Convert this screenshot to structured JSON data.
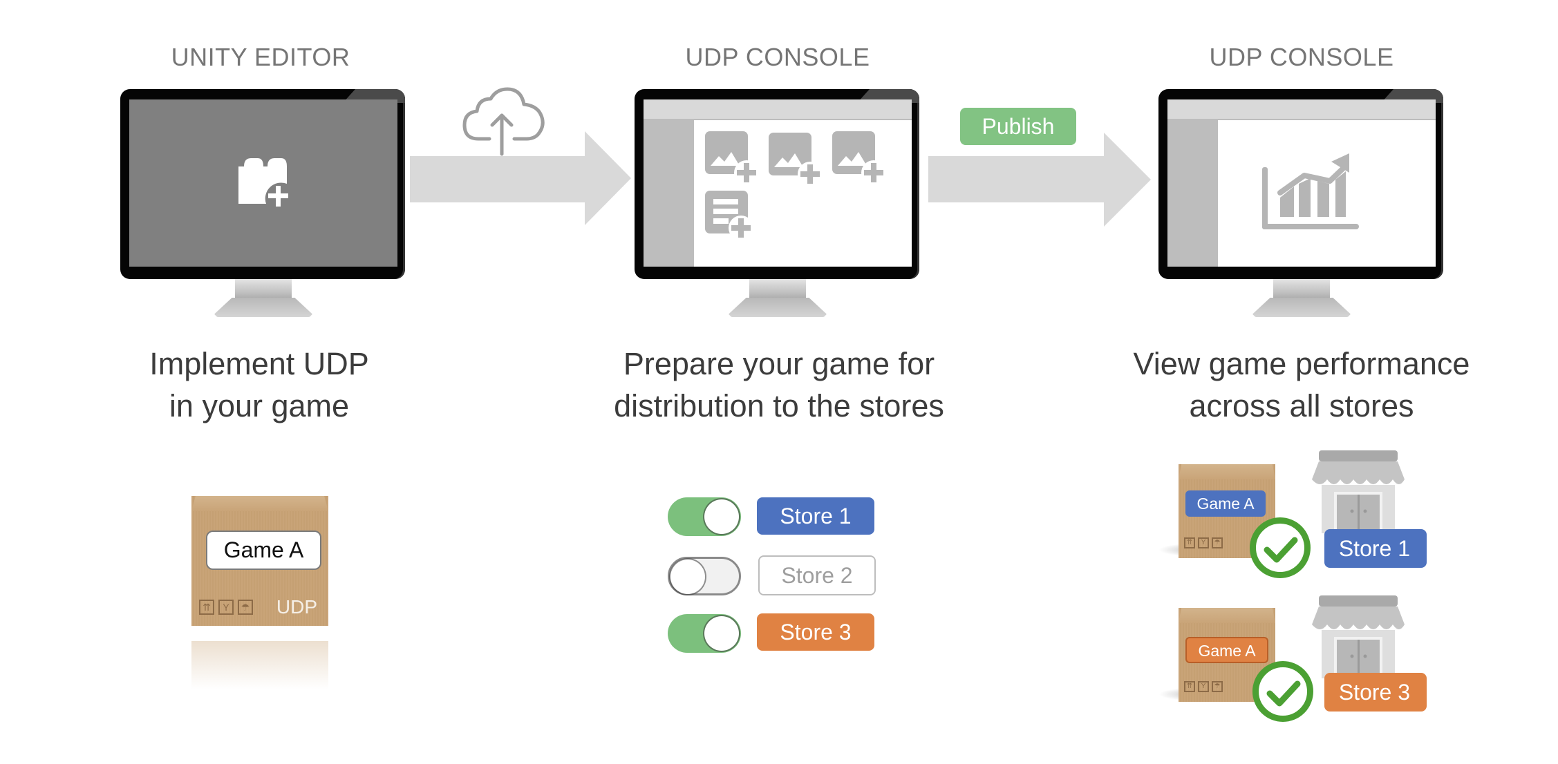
{
  "columns": [
    {
      "title": "UNITY EDITOR",
      "screen_icon": "puzzle-plus-icon",
      "caption_line1": "Implement UDP",
      "caption_line2": "in your game",
      "package": {
        "label": "Game A",
        "brand": "UDP"
      }
    },
    {
      "title": "UDP CONSOLE",
      "screen_icons": [
        "image-add-icon",
        "image-add-icon",
        "image-add-icon",
        "document-add-icon"
      ],
      "caption_line1": "Prepare your game for",
      "caption_line2": "distribution to the stores",
      "stores": [
        {
          "label": "Store 1",
          "enabled": true,
          "color": "#4d72bf"
        },
        {
          "label": "Store 2",
          "enabled": false,
          "color": "#bdbdbd"
        },
        {
          "label": "Store 3",
          "enabled": true,
          "color": "#e08243"
        }
      ]
    },
    {
      "title": "UDP CONSOLE",
      "screen_icon": "growth-chart-icon",
      "caption_line1": "View game performance",
      "caption_line2": "across all stores",
      "published": [
        {
          "game": "Game A",
          "store": "Store 1",
          "color": "#4d72bf",
          "status": "check-icon"
        },
        {
          "game": "Game A",
          "store": "Store 3",
          "color": "#e08243",
          "status": "check-icon"
        }
      ]
    }
  ],
  "arrows": [
    {
      "icon": "cloud-upload-icon"
    },
    {
      "button_label": "Publish",
      "button_color": "#82c383"
    }
  ],
  "colors": {
    "arrow": "#d9d9d9",
    "icon_gray": "#b5b5b5",
    "title_gray": "#757575",
    "caption": "#3c3c3c",
    "check_green": "#4ba033",
    "toggle_on": "#7cc07d"
  }
}
